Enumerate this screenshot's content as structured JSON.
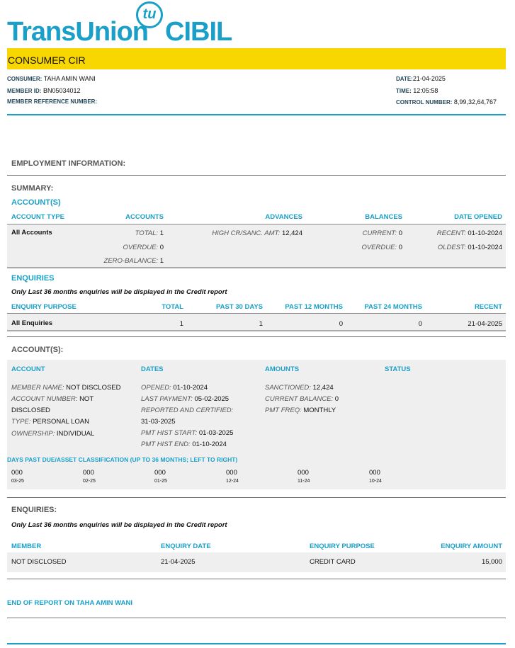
{
  "logo": {
    "brand": "TransUnion",
    "mark": "tu",
    "product": "CIBIL"
  },
  "title": "CONSUMER CIR",
  "header": {
    "consumer_label": "CONSUMER:",
    "consumer": "TAHA AMIN WANI",
    "member_id_label": "MEMBER ID:",
    "member_id": "BN05034012",
    "member_ref_label": "MEMBER REFERENCE NUMBER:",
    "date_label": "DATE:",
    "date": "21-04-2025",
    "time_label": "TIME:",
    "time": "12:05:58",
    "control_label": "CONTROL NUMBER:",
    "control": "8,99,32,64,767"
  },
  "employment": "EMPLOYMENT INFORMATION:",
  "summary": {
    "title": "SUMMARY:",
    "accounts_title": "ACCOUNT(S)",
    "cols": [
      "ACCOUNT TYPE",
      "ACCOUNTS",
      "ADVANCES",
      "BALANCES",
      "DATE OPENED"
    ],
    "row_label": "All Accounts",
    "total_label": "TOTAL:",
    "total": "1",
    "overdue_label": "OVERDUE:",
    "overdue": "0",
    "zero_label": "ZERO-BALANCE:",
    "zero": "1",
    "high_label": "HIGH CR/SANC. AMT:",
    "high": "12,424",
    "current_label": "CURRENT:",
    "current": "0",
    "bal_overdue_label": "OVERDUE:",
    "bal_overdue": "0",
    "recent_label": "RECENT:",
    "recent": "01-10-2024",
    "oldest_label": "OLDEST:",
    "oldest": "01-10-2024"
  },
  "enq_summary": {
    "title": "ENQUIRIES",
    "note": "Only Last 36 months enquiries will be displayed in the Credit report",
    "cols": [
      "ENQUIRY PURPOSE",
      "TOTAL",
      "PAST 30 DAYS",
      "PAST 12 MONTHS",
      "PAST 24 MONTHS",
      "RECENT"
    ],
    "row": [
      "All Enquiries",
      "1",
      "1",
      "0",
      "0",
      "21-04-2025"
    ]
  },
  "accounts": {
    "title": "ACCOUNT(S):",
    "cols": [
      "ACCOUNT",
      "DATES",
      "AMOUNTS",
      "STATUS"
    ],
    "member_name_label": "MEMBER NAME:",
    "member_name": "NOT DISCLOSED",
    "acct_num_label": "ACCOUNT NUMBER:",
    "acct_num_1": "NOT",
    "acct_num_2": "DISCLOSED",
    "type_label": "TYPE:",
    "type": "PERSONAL LOAN",
    "ownership_label": "OWNERSHIP:",
    "ownership": "INDIVIDUAL",
    "opened_label": "OPENED:",
    "opened": "01-10-2024",
    "last_payment_label": "LAST PAYMENT:",
    "last_payment": "05-02-2025",
    "reported_label": "REPORTED AND CERTIFIED:",
    "reported": "31-03-2025",
    "hist_start_label": "PMT HIST START:",
    "hist_start": "01-03-2025",
    "hist_end_label": "PMT HIST END:",
    "hist_end": "01-10-2024",
    "sanctioned_label": "SANCTIONED:",
    "sanctioned": "12,424",
    "cur_bal_label": "CURRENT BALANCE:",
    "cur_bal": "0",
    "freq_label": "PMT FREQ:",
    "freq": "MONTHLY",
    "dpd_title": "DAYS PAST DUE/ASSET CLASSIFICATION (UP TO 36 MONTHS; LEFT TO RIGHT)",
    "dpd": [
      {
        "v": "000",
        "m": "03-25"
      },
      {
        "v": "000",
        "m": "02-25"
      },
      {
        "v": "000",
        "m": "01-25"
      },
      {
        "v": "000",
        "m": "12-24"
      },
      {
        "v": "000",
        "m": "11-24"
      },
      {
        "v": "000",
        "m": "10-24"
      }
    ]
  },
  "enquiries": {
    "title": "ENQUIRIES:",
    "note": "Only Last 36 months enquiries will be displayed in the Credit report",
    "cols": [
      "MEMBER",
      "ENQUIRY DATE",
      "ENQUIRY PURPOSE",
      "ENQUIRY AMOUNT"
    ],
    "row": [
      "NOT DISCLOSED",
      "21-04-2025",
      "CREDIT CARD",
      "15,000"
    ]
  },
  "end": "END OF REPORT ON TAHA AMIN WANI"
}
